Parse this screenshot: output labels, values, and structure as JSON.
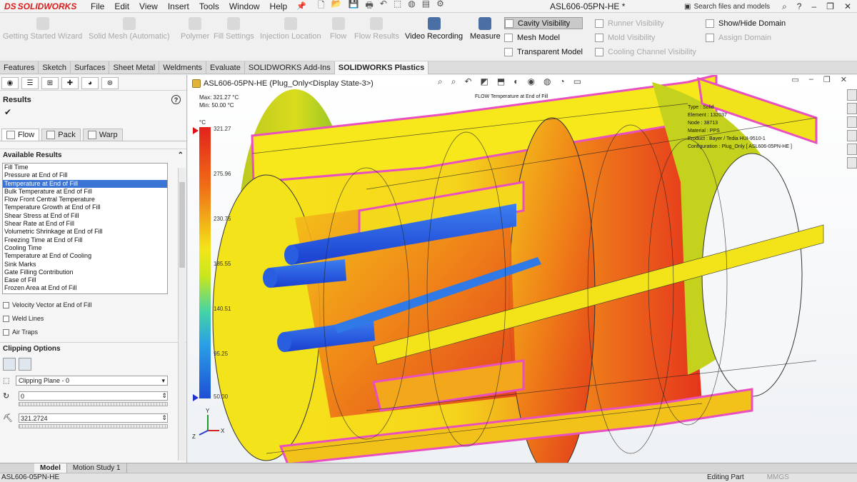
{
  "app": {
    "logo_text": "SOLIDWORKS",
    "logo_prefix": "DS",
    "doc_title": "ASL606-05PN-HE *"
  },
  "menu": [
    "File",
    "Edit",
    "View",
    "Insert",
    "Tools",
    "Window",
    "Help"
  ],
  "search": {
    "placeholder": "Search files and models"
  },
  "ribbon": {
    "disabled_buttons": [
      "Getting Started Wizard",
      "Solid Mesh (Automatic)",
      "Polymer",
      "Fill Settings",
      "Injection Location",
      "Flow",
      "Flow Results"
    ],
    "video_recording": "Video Recording",
    "measure": "Measure",
    "display_list": [
      "Cavity Visibility",
      "Mesh Model",
      "Transparent Model"
    ],
    "visibility_list": [
      "Runner Visibility",
      "Mold Visibility",
      "Cooling Channel Visibility"
    ],
    "domain_list": [
      "Show/Hide Domain",
      "Assign Domain"
    ]
  },
  "tabs": [
    "Features",
    "Sketch",
    "Surfaces",
    "Sheet Metal",
    "Weldments",
    "Evaluate",
    "SOLIDWORKS Add-Ins",
    "SOLIDWORKS Plastics"
  ],
  "active_tab": "SOLIDWORKS Plastics",
  "left_panel": {
    "title": "Results",
    "help": "?",
    "check": "✔",
    "subtabs": [
      "Flow",
      "Pack",
      "Warp"
    ],
    "available_results_label": "Available Results",
    "results": [
      "Fill Time",
      "Pressure at End of Fill",
      "Temperature at End of Fill",
      "Bulk Temperature at End of Fill",
      "Flow Front Central Temperature",
      "Temperature Growth at End of Fill",
      "Shear Stress at End of Fill",
      "Shear Rate at End of Fill",
      "Volumetric Shrinkage at End of Fill",
      "Freezing Time at End of Fill",
      "Cooling Time",
      "Temperature at End of Cooling",
      "Sink Marks",
      "Gate Filling Contribution",
      "Ease of Fill",
      "Frozen Area at End of Fill"
    ],
    "selected_result": "Temperature at End of Fill",
    "checkboxes": [
      "Velocity Vector at End of Fill",
      "Weld Lines",
      "Air Traps"
    ],
    "clipping_label": "Clipping Options",
    "clipping_plane": "Clipping Plane - 0",
    "offset_value": "0",
    "threshold_value": "321.2724"
  },
  "graphics": {
    "tree_label": "ASL606-05PN-HE  (Plug_Only<Display State-3>)",
    "max_label": "Max:  321.27 °C",
    "min_label": "Min:  50.00 °C",
    "unit": "°C",
    "legend_ticks": [
      "321.27",
      "275.96",
      "230.75",
      "185.55",
      "140.51",
      "95.25",
      "50.00"
    ],
    "plot_title": "FLOW Temperature at End of Fill",
    "info": [
      "Type : Solid",
      "Element : 132037",
      "Node : 38713",
      "Material : PPS",
      "Product : Bayer / Tedia HUI-9510-1",
      "Configuration : Plug_Only [ ASL606-05PN-HE ]"
    ],
    "axes": {
      "x": "X",
      "y": "Y",
      "z": "Z"
    },
    "colors": {
      "hot": "#e3221c",
      "warm": "#f3e51a",
      "mid": "#c8e61d",
      "cool": "#2aa0e6",
      "cold": "#1e4fd6",
      "edge": "#e94fc0"
    }
  },
  "bottom_tabs": [
    "Model",
    "Motion Study 1"
  ],
  "status": {
    "doc": "ASL606-05PN-HE",
    "mode": "Editing Part",
    "units": "MMGS"
  }
}
